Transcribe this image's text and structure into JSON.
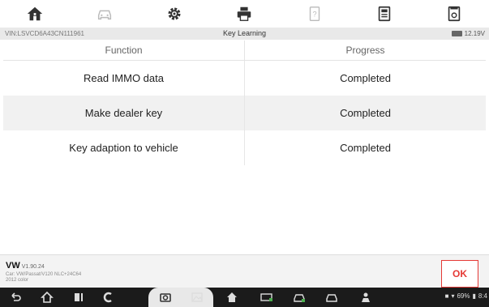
{
  "toolbar": {
    "items": [
      {
        "icon": "home-icon"
      },
      {
        "icon": "vehicle-swap-icon"
      },
      {
        "icon": "gear-icon"
      },
      {
        "icon": "print-icon"
      },
      {
        "icon": "help-icon"
      },
      {
        "icon": "save-icon"
      },
      {
        "icon": "screenshot-icon"
      }
    ]
  },
  "status": {
    "vin": "VIN:LSVCD6A43CN111961",
    "title": "Key Learning",
    "voltage": "12.19V"
  },
  "table": {
    "headers": [
      "Function",
      "Progress"
    ],
    "rows": [
      {
        "function": "Read IMMO data",
        "progress": "Completed"
      },
      {
        "function": "Make dealer key",
        "progress": "Completed"
      },
      {
        "function": "Key adaption to vehicle",
        "progress": "Completed"
      }
    ]
  },
  "footer": {
    "brand": "VW",
    "version": "V1.90.24",
    "car_line1": "Car: VW/Passat/V120 NLC+24C64",
    "car_line2": "2012 color",
    "ok_label": "OK"
  },
  "system": {
    "battery": "69%",
    "clock": "8:4"
  },
  "colors": {
    "accent": "#e53935",
    "nav_bg": "#1b1b1b",
    "status_bg": "#e9e9e9"
  }
}
